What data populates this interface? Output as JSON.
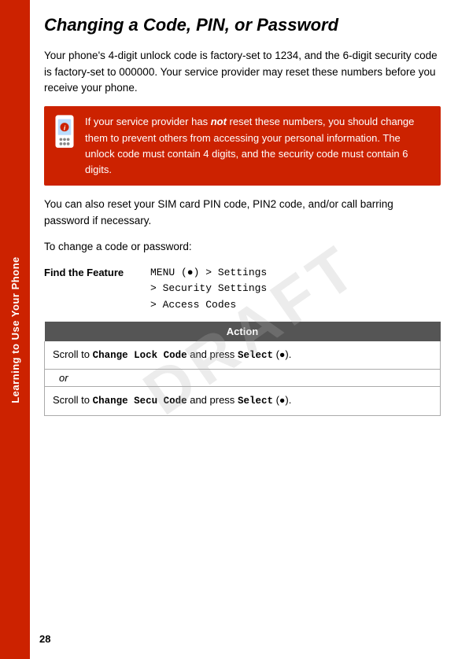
{
  "sidebar": {
    "label": "Learning to Use Your Phone",
    "bg_color": "#cc2200"
  },
  "watermark": "DRAFT",
  "page": {
    "number": "28",
    "title": "Changing a Code, PIN, or Password",
    "intro_text": "Your phone's 4-digit unlock code is factory-set to 1234, and the 6-digit security code is factory-set to 000000. Your service provider may reset these numbers before you receive your phone.",
    "info_box_text_1": "If your service provider has ",
    "info_box_italic": "not",
    "info_box_text_2": " reset these numbers, you should change them to prevent others from accessing your personal information. The unlock code must contain 4 digits, and the security code must contain 6 digits.",
    "body_text_2": "You can also reset your SIM card PIN code, PIN2 code, and/or call barring password if necessary.",
    "body_text_3": "To change a code or password:",
    "find_feature": {
      "label": "Find the Feature",
      "line1": "MENU (●) > Settings",
      "line2": "> Security Settings",
      "line3": "> Access Codes"
    },
    "action_table": {
      "header": "Action",
      "row1": "Scroll to Change Lock Code and press Select (●).",
      "or": "or",
      "row2": "Scroll to Change Secu Code and press Select (●)."
    }
  }
}
